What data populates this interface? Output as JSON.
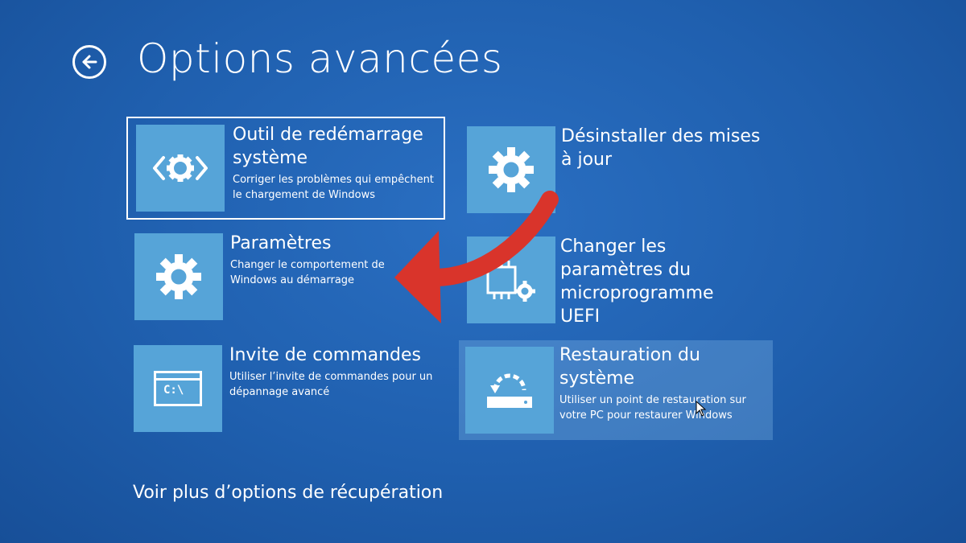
{
  "header": {
    "title": "Options avancées",
    "back_icon": "back-arrow-icon"
  },
  "tiles": [
    {
      "id": "startup-repair",
      "icon": "code-gear-icon",
      "title": "Outil de redémarrage\nsystème",
      "description": "Corriger les problèmes qui empêchent\nle chargement de Windows"
    },
    {
      "id": "uninstall-updates",
      "icon": "gear-icon",
      "title": "Désinstaller des mises\nà jour",
      "description": ""
    },
    {
      "id": "startup-settings",
      "icon": "gear-icon",
      "title": "Paramètres",
      "description": "Changer le comportement de\nWindows au démarrage"
    },
    {
      "id": "uefi-settings",
      "icon": "chip-gear-icon",
      "title": "Changer les\nparamètres du\nmicroprogramme\nUEFI",
      "description": ""
    },
    {
      "id": "command-prompt",
      "icon": "command-prompt-icon",
      "icon_text": "C:\\",
      "title": "Invite de commandes",
      "description": "Utiliser l’invite de commandes pour un\ndépannage avancé"
    },
    {
      "id": "system-restore",
      "icon": "restore-icon",
      "title": "Restauration du\nsystème",
      "description": "Utiliser un point de restauration sur\nvotre PC pour restaurer Windows"
    }
  ],
  "footer": {
    "more_options": "Voir plus d’options de récupération"
  },
  "colors": {
    "background": "#1f5fae",
    "tile_icon_bg": "#56a4d8",
    "text": "#ffffff",
    "annotation_arrow": "#d9342b"
  }
}
